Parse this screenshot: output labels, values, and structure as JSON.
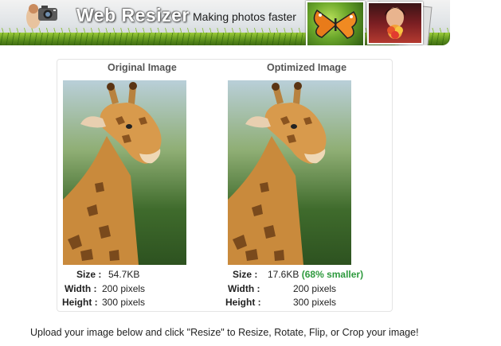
{
  "header": {
    "brand": "Web Resizer",
    "tagline": "Making photos faster",
    "colors": {
      "banner_top": "#f2f2f2",
      "banner_bottom": "#c7ccd0",
      "grass": "#6aa02a"
    }
  },
  "original": {
    "title": "Original Image",
    "size_label": "Size :",
    "size_value": "54.7KB",
    "width_label": "Width :",
    "width_value": "200 pixels",
    "height_label": "Height :",
    "height_value": "300 pixels"
  },
  "optimized": {
    "title": "Optimized Image",
    "size_label": "Size :",
    "size_value": "17.6KB",
    "size_pct": "(68% smaller)",
    "width_label": "Width :",
    "width_value": "200 pixels",
    "height_label": "Height :",
    "height_value": "300 pixels",
    "colors": {
      "savings": "#2e9a3e"
    }
  },
  "instructions": "Upload your image below and click \"Resize\" to Resize, Rotate, Flip, or Crop your image!"
}
